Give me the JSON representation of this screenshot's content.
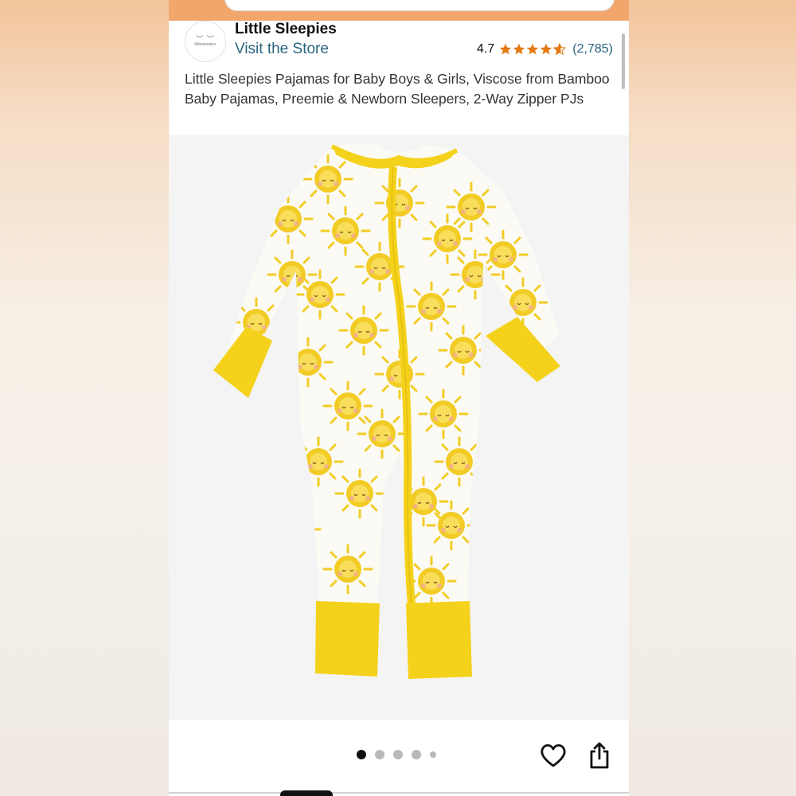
{
  "store": {
    "name": "Little Sleepies",
    "link_label": "Visit the Store",
    "logo_text": "littlesleepies"
  },
  "rating": {
    "value": "4.7",
    "stars": 4.7,
    "count": "(2,785)"
  },
  "product": {
    "title": "Little Sleepies Pajamas for Baby Boys & Girls, Viscose from Bamboo Baby Pajamas, Preemie & Newborn Sleepers, 2-Way Zipper PJs"
  },
  "carousel": {
    "total_dots": 5,
    "active_index": 0
  },
  "icons": {
    "favorite": "heart-icon",
    "share": "share-icon"
  },
  "colors": {
    "accent_orange": "#f2a66b",
    "star": "#e47911",
    "link": "#2a6580",
    "garment_yellow": "#f4d21b"
  }
}
